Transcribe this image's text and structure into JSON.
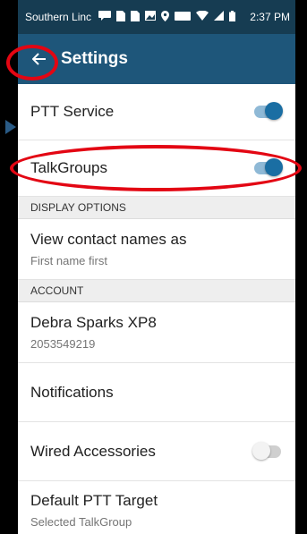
{
  "status_bar": {
    "carrier": "Southern Linc",
    "time": "2:37 PM",
    "icons": [
      "message-icon",
      "sim-icon",
      "sim-icon",
      "image-icon",
      "location-icon",
      "vowifi-icon",
      "wifi-icon",
      "signal-icon",
      "battery-icon"
    ]
  },
  "app_bar": {
    "title": "Settings",
    "back_icon": "arrow-left-icon"
  },
  "settings": {
    "ptt_service": {
      "label": "PTT Service",
      "enabled": true
    },
    "talkgroups": {
      "label": "TalkGroups",
      "enabled": true
    },
    "display_options_header": "DISPLAY OPTIONS",
    "view_contact_names": {
      "label": "View contact names as",
      "value": "First name first"
    },
    "account_header": "ACCOUNT",
    "account": {
      "name": "Debra Sparks XP8",
      "number": "2053549219"
    },
    "notifications": {
      "label": "Notifications"
    },
    "wired_accessories": {
      "label": "Wired Accessories",
      "enabled": false
    },
    "default_ptt_target": {
      "label": "Default PTT Target",
      "value": "Selected TalkGroup"
    }
  },
  "colors": {
    "status_bar": "#163c52",
    "app_bar": "#1e567a",
    "toggle_on": "#1a6ea3",
    "annotation": "#e30613"
  }
}
